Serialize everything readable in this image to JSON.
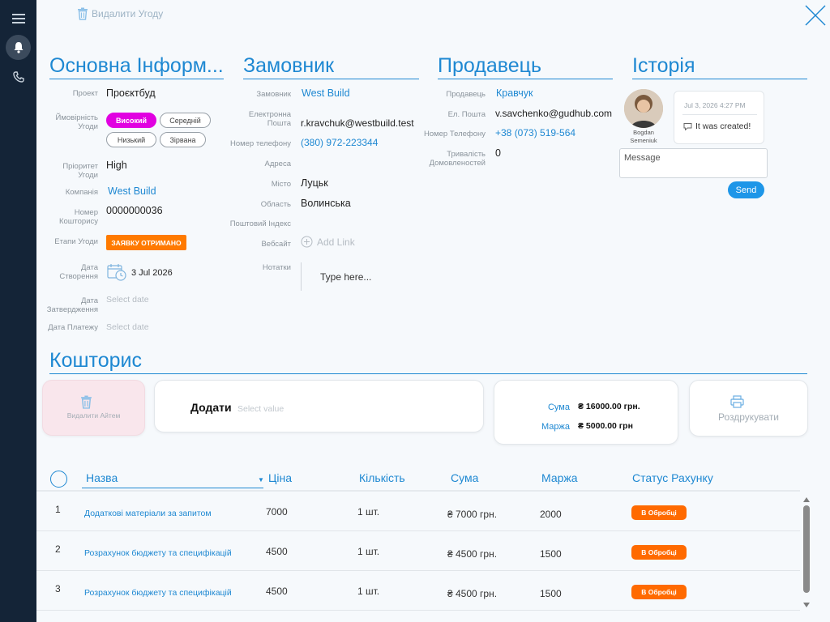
{
  "header": {
    "delete_deal": "Видалити Угоду"
  },
  "sections": {
    "main": "Основна Інформ...",
    "customer": "Замовник",
    "seller": "Продавець",
    "history": "Історія",
    "estimate": "Кошторис"
  },
  "main_info": {
    "project_label": "Проект",
    "project_value": "Проєктбуд",
    "probability_label": "Ймовірність Угоди",
    "probability_options": [
      "Високий",
      "Середній",
      "Низький",
      "Зірвана"
    ],
    "probability_selected": "Високий",
    "priority_label": "Пріоритет Угоди",
    "priority_value": "High",
    "company_label": "Компанія",
    "company_value": "West Build",
    "estimate_no_label": "Номер Кошторису",
    "estimate_no_value": "0000000036",
    "stage_label": "Етапи Угоди",
    "stage_value": "ЗАЯВКУ ОТРИМАНО",
    "created_label": "Дата Створення",
    "created_value": "3 Jul 2026",
    "approved_label": "Дата Затвердження",
    "approved_placeholder": "Select date",
    "payment_label": "Дата Платежу",
    "payment_placeholder": "Select date"
  },
  "customer": {
    "customer_label": "Замовник",
    "customer_value": "West Build",
    "email_label": "Електронна Пошта",
    "email_value": "r.kravchuk@westbuild.test",
    "phone_label": "Номер телефону",
    "phone_value": "(380) 972-223344",
    "address_label": "Адреса",
    "city_label": "Місто",
    "city_value": "Луцьк",
    "region_label": "Область",
    "region_value": "Волинська",
    "zip_label": "Поштовий Індекс",
    "website_label": "Вебсайт",
    "website_add": "Add Link",
    "notes_label": "Нотатки",
    "notes_placeholder": "Type here..."
  },
  "seller": {
    "seller_label": "Продавець",
    "seller_value": "Кравчук",
    "email_label": "Ел. Пошта",
    "email_value": "v.savchenko@gudhub.com",
    "phone_label": "Номер Телефону",
    "phone_value": "+38 (073) 519-564",
    "duration_label": "Тривалість Домовленостей",
    "duration_value": "0"
  },
  "history": {
    "user_name": "Bogdan Semeniuk",
    "timestamp": "Jul 3, 2026 4:27 PM",
    "message": "It was created!",
    "message_placeholder": "Message",
    "send_label": "Send"
  },
  "estimate": {
    "delete_item": "Видалити Айтем",
    "add_label": "Додати",
    "add_placeholder": "Select value",
    "sum_label": "Сума",
    "sum_value": "₴ 16000.00 грн.",
    "margin_label": "Маржа",
    "margin_value": "₴ 5000.00 грн",
    "print_label": "Роздрукувати"
  },
  "table": {
    "columns": [
      "Назва",
      "Ціна",
      "Кількість",
      "Сума",
      "Маржа",
      "Статус Рахунку"
    ],
    "rows": [
      {
        "num": "1",
        "name": "Додаткові матеріали за запитом",
        "price": "7000",
        "qty": "1 шт.",
        "sum": "₴ 7000 грн.",
        "margin": "2000",
        "status": "В Обробці"
      },
      {
        "num": "2",
        "name": "Розрахунок бюджету та специфікацій",
        "price": "4500",
        "qty": "1 шт.",
        "sum": "₴ 4500 грн.",
        "margin": "1500",
        "status": "В Обробці"
      },
      {
        "num": "3",
        "name": "Розрахунок бюджету та специфікацій",
        "price": "4500",
        "qty": "1 шт.",
        "sum": "₴ 4500 грн.",
        "margin": "1500",
        "status": "В Обробці"
      }
    ]
  },
  "colors": {
    "accent": "#1e88d2",
    "sidebar": "#142437",
    "selected_pill": "#e100e1",
    "stage_badge": "#ff7a00",
    "status_badge": "#ff6a00",
    "send_button": "#1e96e8"
  }
}
